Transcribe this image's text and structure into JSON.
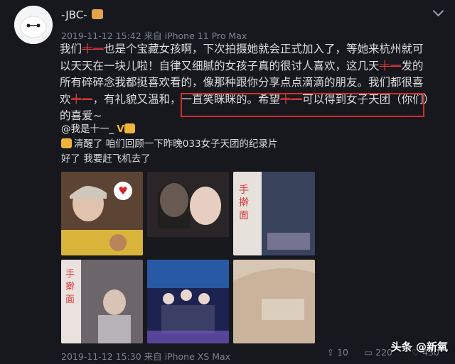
{
  "post": {
    "username": "-JBC-",
    "meta": "2019-11-12 15:42 来自 iPhone 11 Pro Max",
    "content": {
      "p1": "我们",
      "mention1": "十一",
      "p2": "也是个宝藏女孩啊，下次拍摄她就会正式加入了，等她来杭州就可以天天在一块儿啦！自律又细腻的女孩子真的很讨人喜欢，这几天",
      "mention2": "十一",
      "p3": "发的所有碎碎念我都挺喜欢看的，像那种跟你分享点点滴滴的朋友。我们都很喜欢",
      "mention3": "十一",
      "p4": "，有礼貌又温和，一直笑眯眯的。",
      "p5": "希望",
      "mention4": "十一",
      "p6": "可以得到女子天团（你们）的喜爱~"
    }
  },
  "repost": {
    "author": "@我是十一_",
    "line1": "清醒了 咱们回顾一下昨晚033女子天团的纪录片",
    "line2": "好了 我要赶飞机去了"
  },
  "photos": [
    {
      "icon": "heart-icon",
      "caption": "",
      "colors": [
        "#6b4a3a",
        "#c9a35a",
        "#2b2220"
      ]
    },
    {
      "icon": "",
      "caption": "",
      "colors": [
        "#3a3435",
        "#8b7a72",
        "#c0b0a8"
      ]
    },
    {
      "icon": "",
      "caption": "",
      "colors": [
        "#44506a",
        "#b9b2b0",
        "#e7e2e0"
      ]
    },
    {
      "icon": "",
      "caption": "",
      "colors": [
        "#5b5258",
        "#a8a0a8",
        "#d9c9c0"
      ]
    },
    {
      "icon": "",
      "caption": "",
      "colors": [
        "#1f2b5a",
        "#3aa0d8",
        "#9d6bd0"
      ]
    },
    {
      "icon": "",
      "caption": "",
      "colors": [
        "#4a423c",
        "#c9b49a",
        "#efe4d6"
      ]
    }
  ],
  "footer": {
    "meta": "2019-11-12 15:30 来自 iPhone XS Max",
    "share_count": "10",
    "comment_count": "220",
    "like_count": "430"
  },
  "watermark": "头条 @新氧"
}
